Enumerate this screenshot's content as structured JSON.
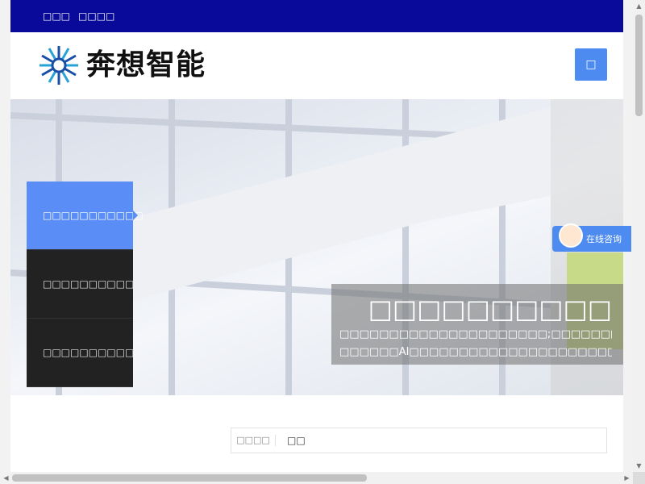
{
  "topbar": {
    "links": [
      "□□□",
      "□□□□"
    ]
  },
  "header": {
    "logo_text": "奔想智能",
    "menu_icon": "□"
  },
  "banner": {
    "side_menu": [
      "□□□□□□□□□□□",
      "□□□□□□□□□□",
      "□□□□□□□□□□"
    ],
    "caption_title": "□□□□□□□□□□",
    "caption_line1": "□□□□□□□□□□□□□□□□□□□□□;□□□□□□□□□□□□□",
    "caption_line2": "□□□□□□AI□□□□□□□□□□□□□□□□□□□□□□□□□□"
  },
  "consult": {
    "label": "在线咨询"
  },
  "search": {
    "type_label": "□□□□",
    "input_value": "□□"
  },
  "colors": {
    "topbar": "#0a0a9a",
    "accent": "#4d8bf0",
    "menu_dark": "#222222"
  }
}
